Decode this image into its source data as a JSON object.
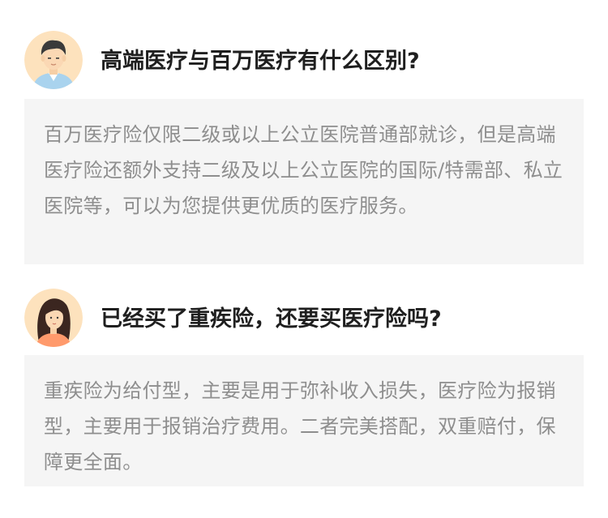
{
  "items": [
    {
      "avatar_icon": "male-avatar-icon",
      "question": "高端医疗与百万医疗有什么区别?",
      "answer": "百万医疗险仅限二级或以上公立医院普通部就诊，但是高端医疗险还额外支持二级及以上公立医院的国际/特需部、私立医院等，可以为您提供更优质的医疗服务。"
    },
    {
      "avatar_icon": "female-avatar-icon",
      "question": "已经买了重疾险，还要买医疗险吗?",
      "answer": "重疾险为给付型，主要是用于弥补收入损失，医疗险为报销型，主要用于报销治疗费用。二者完美搭配，双重赔付，保障更全面。"
    }
  ],
  "colors": {
    "answer_bg": "#f5f5f5",
    "answer_text": "#8e8e8e",
    "question_text": "#1f1f1f",
    "avatar_bg": "#fde5c2"
  }
}
